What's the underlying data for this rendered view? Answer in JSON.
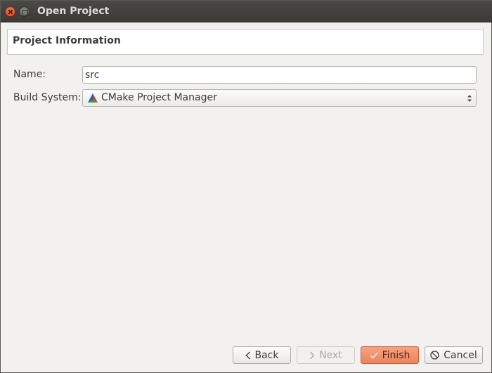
{
  "window": {
    "title": "Open Project"
  },
  "header": {
    "title": "Project Information"
  },
  "form": {
    "name_label": "Name:",
    "name_value": "src",
    "build_system_label": "Build System:",
    "build_system_value": "CMake Project Manager",
    "build_system_icon": "cmake-icon"
  },
  "buttons": {
    "back": "Back",
    "next": "Next",
    "finish": "Finish",
    "cancel": "Cancel"
  },
  "colors": {
    "titlebar": "#3b3a36",
    "close": "#dd4c1f",
    "finish_accent": "#ef8259"
  }
}
